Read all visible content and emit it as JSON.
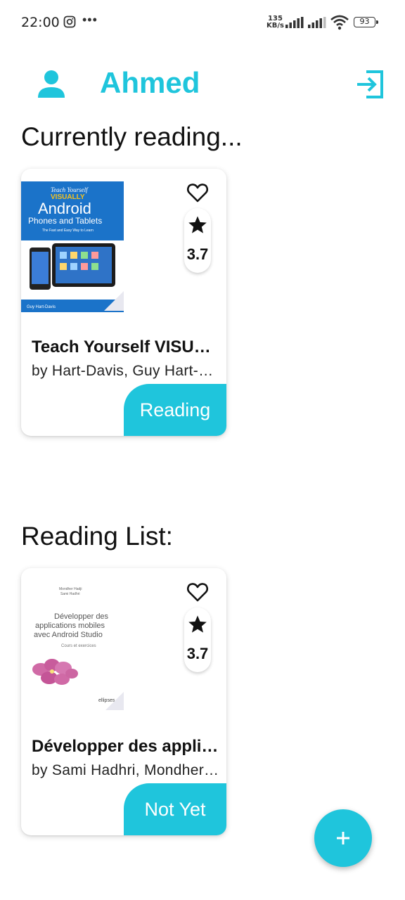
{
  "status_bar": {
    "time": "22:00",
    "net_speed_value": "135",
    "net_speed_unit": "KB/s",
    "battery": "93",
    "icons": [
      "instagram-icon",
      "more-dots-icon",
      "signal-icon",
      "signal-icon",
      "wifi-icon",
      "battery-icon"
    ]
  },
  "header": {
    "username": "Ahmed",
    "icons": [
      "user-icon",
      "logout-icon"
    ],
    "accent_color": "#1fc5dc"
  },
  "sections": {
    "currently_reading": {
      "title": "Currently reading...",
      "book": {
        "cover_text": {
          "series": "Teach Yourself",
          "brand": "VISUALLY",
          "title1": "Android",
          "title2": "Phones and Tablets",
          "tagline": "The Fast and Easy Way to Learn",
          "author": "Guy Hart-Davis"
        },
        "title": "Teach Yourself VISUALLY Android Phones and Tablets",
        "author": "by Hart-Davis, Guy Hart-Davis",
        "rating": "3.7",
        "status": "Reading"
      }
    },
    "reading_list": {
      "title": "Reading List:",
      "book": {
        "cover_text": {
          "authors_line1": "Mondher Hadji",
          "authors_line2": "Sami Hadhri",
          "title1": "Développer des",
          "title2": "applications mobiles",
          "title3": "avec Android Studio",
          "subtitle": "Cours et exercices",
          "publisher": "ellipses"
        },
        "title": "Développer des applications mobiles avec Android Studio",
        "author": "by Sami Hadhri, Mondher Hadji",
        "rating": "3.7",
        "status": "Not Yet"
      }
    }
  },
  "fab": {
    "icon": "plus-icon"
  }
}
